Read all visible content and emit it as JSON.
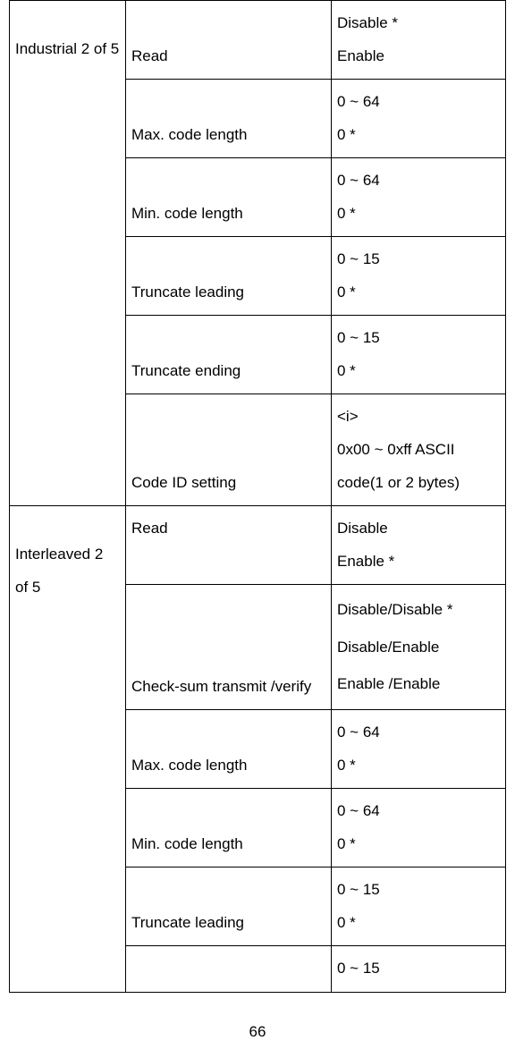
{
  "rows": [
    {
      "c1": "Industrial 2 of 5",
      "c1rs": 6,
      "c2": "Read",
      "c2cls": "param",
      "v": "Disable *\nEnable"
    },
    {
      "c2": "Max. code length",
      "c2cls": "param",
      "v": "0 ~ 64\n0 *"
    },
    {
      "c2": "Min. code length",
      "c2cls": "param",
      "v": "0 ~ 64\n0 *"
    },
    {
      "c2": "Truncate leading",
      "c2cls": "param",
      "v": "0 ~ 15\n0 *"
    },
    {
      "c2": "Truncate ending",
      "c2cls": "param",
      "v": "0 ~ 15\n0 *"
    },
    {
      "c2": "Code ID setting",
      "c2cls": "param",
      "v": "<i>\n0x00 ~ 0xff ASCII code(1 or 2 bytes)"
    },
    {
      "c1": "Interleaved 2 of 5",
      "c1rs": 7,
      "c2": "Read",
      "c2cls": "param readcell",
      "v": "Disable\nEnable *"
    },
    {
      "c2": "Check-sum transmit /verify",
      "c2cls": "param",
      "v": "Disable/Disable *\nDisable/Enable\nEnable /Enable",
      "vlh": "2.45"
    },
    {
      "c2": "Max. code length",
      "c2cls": "param",
      "v": "0 ~ 64\n0 *"
    },
    {
      "c2": "Min. code length",
      "c2cls": "param",
      "v": "0 ~ 64\n0 *"
    },
    {
      "c2": "Truncate leading",
      "c2cls": "param",
      "v": "0 ~ 15\n0 *"
    },
    {
      "c2": "",
      "c2cls": "param",
      "v": "0 ~ 15"
    }
  ],
  "pageNumber": "66",
  "colWidths": {
    "c1": "130",
    "c2": "230",
    "c3": "195"
  }
}
